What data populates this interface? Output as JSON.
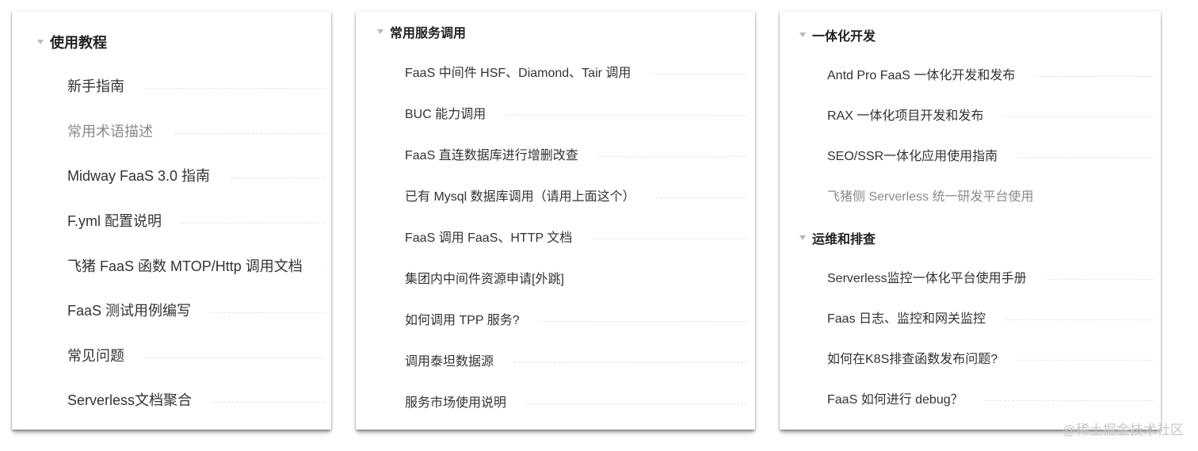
{
  "panels": [
    {
      "sections": [
        {
          "title": "使用教程",
          "items": [
            {
              "label": "新手指南"
            },
            {
              "label": "常用术语描述"
            },
            {
              "label": "Midway FaaS 3.0 指南"
            },
            {
              "label": "F.yml 配置说明"
            },
            {
              "label": "飞猪 FaaS 函数 MTOP/Http 调用文档"
            },
            {
              "label": "FaaS 测试用例编写"
            },
            {
              "label": "常见问题"
            },
            {
              "label": "Serverless文档聚合"
            }
          ]
        }
      ]
    },
    {
      "sections": [
        {
          "title": "常用服务调用",
          "items": [
            {
              "label": "FaaS 中间件  HSF、Diamond、Tair 调用"
            },
            {
              "label": "BUC 能力调用"
            },
            {
              "label": "FaaS 直连数据库进行增删改查"
            },
            {
              "label": "已有 Mysql 数据库调用（请用上面这个）"
            },
            {
              "label": "FaaS 调用 FaaS、HTTP 文档"
            },
            {
              "label": "集团内中间件资源申请[外跳]"
            },
            {
              "label": "如何调用 TPP 服务?"
            },
            {
              "label": "调用泰坦数据源"
            },
            {
              "label": "服务市场使用说明"
            }
          ]
        }
      ]
    },
    {
      "sections": [
        {
          "title": "一体化开发",
          "items": [
            {
              "label": "Antd Pro FaaS 一体化开发和发布"
            },
            {
              "label": "RAX 一体化项目开发和发布"
            },
            {
              "label": "SEO/SSR一体化应用使用指南"
            },
            {
              "label": "飞猪侧 Serverless 统一研发平台使用"
            }
          ]
        },
        {
          "title": "运维和排查",
          "items": [
            {
              "label": "Serverless监控一体化平台使用手册"
            },
            {
              "label": "Faas 日志、监控和网关监控"
            },
            {
              "label": "如何在K8S排查函数发布问题?"
            },
            {
              "label": "FaaS 如何进行 debug？"
            }
          ]
        }
      ]
    }
  ],
  "watermark": "@稀土掘金技术社区",
  "colors": {
    "text": "#333333",
    "muted_text": "#8a8a8a",
    "caret": "#b8b8b8",
    "leader": "#e4e4e4"
  }
}
